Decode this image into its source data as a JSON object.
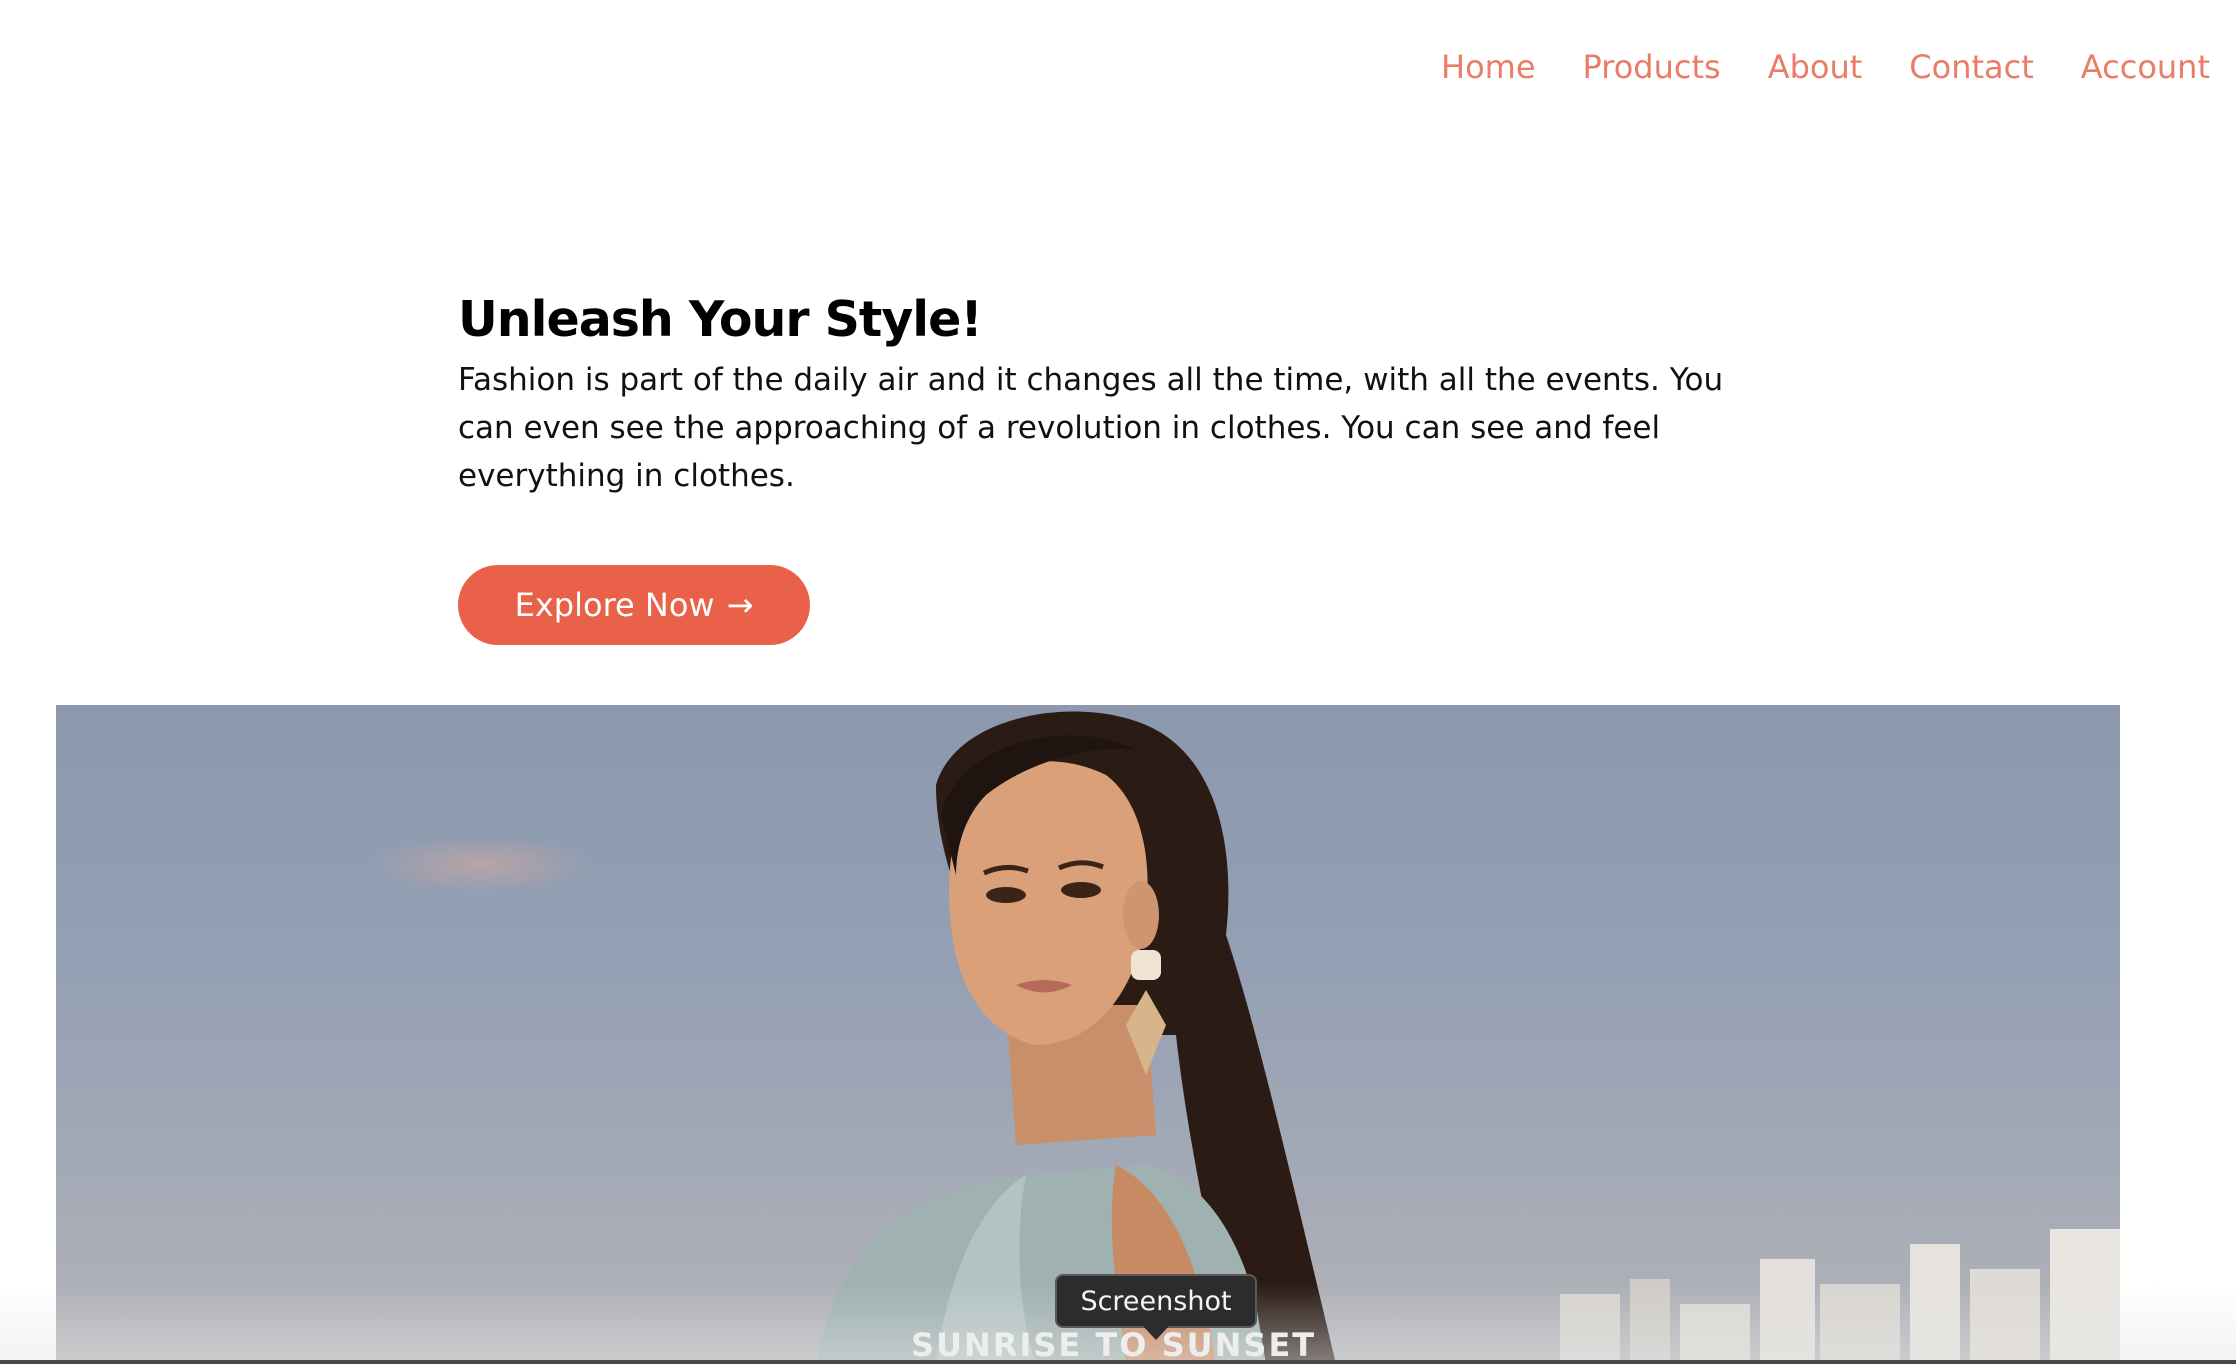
{
  "nav": {
    "items": [
      {
        "label": "Home"
      },
      {
        "label": "Products"
      },
      {
        "label": "About"
      },
      {
        "label": "Contact"
      },
      {
        "label": "Account"
      }
    ]
  },
  "hero": {
    "title": "Unleash Your Style!",
    "text": "Fashion is part of the daily air and it changes all the time, with all the events. You can even see the approaching of a revolution in clothes. You can see and feel everything in clothes.",
    "cta_label": "Explore Now",
    "cta_arrow": "→"
  },
  "image": {
    "caption": "SUNRISE TO SUNSET"
  },
  "tooltip": {
    "label": "Screenshot"
  },
  "colors": {
    "accent": "#ea6149",
    "nav_link": "#ea7c68",
    "text": "#000000",
    "background": "#ffffff"
  }
}
